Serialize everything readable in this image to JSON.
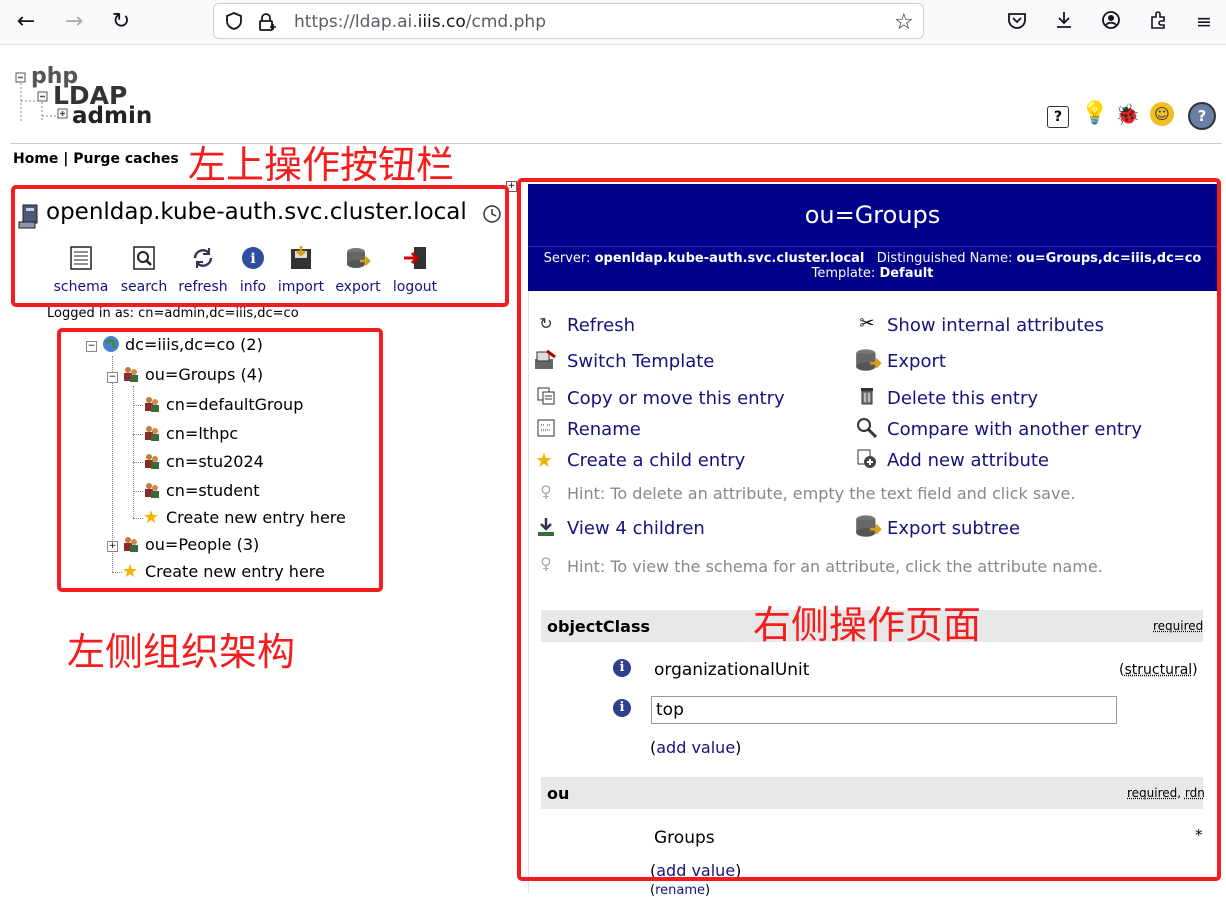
{
  "browser": {
    "url": "https://ldap.ai.iiis.co/cmd.php",
    "url_prefix": "https://ldap.ai.",
    "url_domain": "iiis.co",
    "url_suffix": "/cmd.php"
  },
  "header": {
    "logo_php": "php",
    "logo_ldap": "LDAP",
    "logo_admin": "admin",
    "menu_home": "Home",
    "menu_sep": "|",
    "menu_purge": "Purge caches"
  },
  "annotations": {
    "top_left": "左上操作按钮栏",
    "left": "左侧组织架构",
    "right": "右侧操作页面"
  },
  "server": {
    "name": "openldap.kube-auth.svc.cluster.local",
    "tools": [
      "schema",
      "search",
      "refresh",
      "info",
      "import",
      "export",
      "logout"
    ],
    "logged_in": "Logged in as: cn=admin,dc=iiis,dc=co",
    "expand_glyph": "+"
  },
  "tree": {
    "root": "dc=iiis,dc=co (2)",
    "groups": "ou=Groups (4)",
    "children": [
      "cn=defaultGroup",
      "cn=lthpc",
      "cn=stu2024",
      "cn=student"
    ],
    "create_groups": "Create new entry here",
    "people": "ou=People (3)",
    "create_root": "Create new entry here"
  },
  "panel": {
    "title": "ou=Groups",
    "server_label": "Server:",
    "server_value": "openldap.kube-auth.svc.cluster.local",
    "dn_label": "Distinguished Name:",
    "dn_value": "ou=Groups,dc=iiis,dc=co",
    "template_label": "Template:",
    "template_value": "Default",
    "actions_left": [
      "Refresh",
      "Switch Template",
      "Copy or move this entry",
      "Rename",
      "Create a child entry"
    ],
    "actions_right": [
      "Show internal attributes",
      "Export",
      "Delete this entry",
      "Compare with another entry",
      "Add new attribute"
    ],
    "hint1": "Hint: To delete an attribute, empty the text field and click save.",
    "view_children": "View 4 children",
    "export_subtree": "Export subtree",
    "hint2": "Hint: To view the schema for an attribute, click the attribute name."
  },
  "attributes": {
    "objectclass": {
      "name": "objectClass",
      "required": "required",
      "value1": "organizationalUnit",
      "structural": "structural",
      "value2": "top",
      "add_value": "add value"
    },
    "ou": {
      "name": "ou",
      "required": "required",
      "rdn": "rdn",
      "value": "Groups",
      "asterisk": "*",
      "add_value": "add value",
      "rename": "rename"
    }
  }
}
